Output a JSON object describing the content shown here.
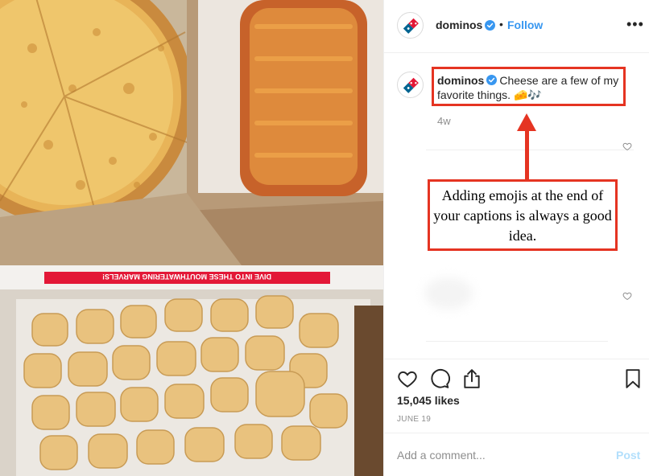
{
  "post": {
    "username": "dominos",
    "follow_separator": "•",
    "follow_label": "Follow",
    "more_label": "•••"
  },
  "caption": {
    "username": "dominos",
    "text": "Cheese are a few of my favorite things.",
    "emojis": "🧀🎶",
    "time_ago": "4w"
  },
  "photo": {
    "box_banner_text": "DIVE INTO THESE MOUTHWATERING MARVELS!"
  },
  "annotation": {
    "text": "Adding emojis at the end of your captions is always a good idea."
  },
  "stats": {
    "likes": "15,045 likes",
    "date": "JUNE 19"
  },
  "comment": {
    "placeholder": "Add a comment...",
    "post_label": "Post"
  },
  "colors": {
    "accent": "#3897f0",
    "annotation_red": "#e53422",
    "domino_blue": "#006491",
    "domino_red": "#e31837",
    "post_disabled": "#b2dffc"
  }
}
